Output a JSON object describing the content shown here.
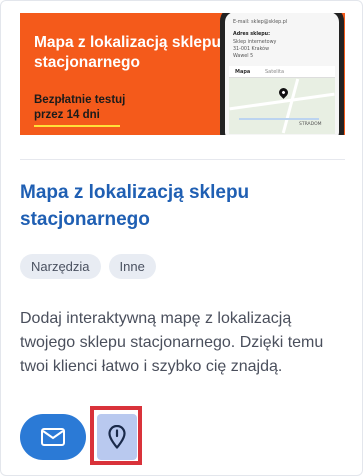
{
  "banner": {
    "title": "Mapa z lokalizacją sklepu stacjonarnego",
    "cta": "Bezpłatnie testuj przez 14 dni",
    "phone": {
      "email_line": "E-mail: sklep@sklep.pl",
      "address_label": "Adres sklepu:",
      "address_lines": [
        "Sklep internetowy",
        "31-001 Kraków",
        "Wawel 5"
      ],
      "tab_map": "Mapa",
      "tab_satellite": "Satelita",
      "map_label": "STRADOM"
    }
  },
  "card": {
    "title": "Mapa z lokalizacją sklepu stacjonarnego",
    "tags": [
      "Narzędzia",
      "Inne"
    ],
    "description": "Dodaj interaktywną mapę z lokalizacją twojego sklepu stacjonarnego. Dzięki temu twoi klienci łatwo i szybko cię znajdą."
  },
  "actions": {
    "mail_icon": "envelope-icon",
    "pin_icon": "map-pin-icon"
  },
  "colors": {
    "banner_bg": "#f45a1b",
    "title": "#1f5fb3",
    "mail_button": "#2b7ad6",
    "pin_button": "#b9c9ef",
    "highlight": "#d9323a"
  }
}
